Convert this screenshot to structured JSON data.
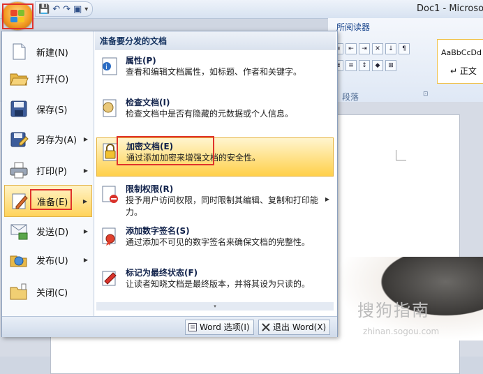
{
  "window": {
    "title": "Doc1 - Microso"
  },
  "quick_access": {
    "save": "💾",
    "undo": "↶",
    "redo": "↷",
    "view": "▣",
    "more": "▾"
  },
  "ribbon": {
    "tab_partial": "所阅读器",
    "group_paragraph": "段落",
    "launcher": "⊡",
    "style_sample": "AaBbCcDd",
    "style_name": "↵ 正文"
  },
  "office_menu": {
    "left_items": [
      {
        "label": "新建(N)",
        "icon": "new-document-icon",
        "has_submenu": false
      },
      {
        "label": "打开(O)",
        "icon": "open-folder-icon",
        "has_submenu": false
      },
      {
        "label": "保存(S)",
        "icon": "save-disk-icon",
        "has_submenu": false
      },
      {
        "label": "另存为(A)",
        "icon": "save-as-icon",
        "has_submenu": true
      },
      {
        "label": "打印(P)",
        "icon": "printer-icon",
        "has_submenu": true
      },
      {
        "label": "准备(E)",
        "icon": "prepare-icon",
        "has_submenu": true,
        "selected": true
      },
      {
        "label": "发送(D)",
        "icon": "send-icon",
        "has_submenu": true
      },
      {
        "label": "发布(U)",
        "icon": "publish-icon",
        "has_submenu": true
      },
      {
        "label": "关闭(C)",
        "icon": "close-folder-icon",
        "has_submenu": false
      }
    ],
    "submenu": {
      "header": "准备要分发的文档",
      "items": [
        {
          "title": "属性(P)",
          "desc": "查看和编辑文档属性，如标题、作者和关键字。",
          "icon": "properties-icon"
        },
        {
          "title": "检查文档(I)",
          "desc": "检查文档中是否有隐藏的元数据或个人信息。",
          "icon": "inspect-document-icon"
        },
        {
          "title": "加密文档(E)",
          "desc": "通过添加加密来增强文档的安全性。",
          "icon": "encrypt-lock-icon",
          "selected": true
        },
        {
          "title": "限制权限(R)",
          "desc": "授予用户访问权限，同时限制其编辑、复制和打印能力。",
          "icon": "restrict-permission-icon",
          "has_submenu": true
        },
        {
          "title": "添加数字签名(S)",
          "desc": "通过添加不可见的数字签名来确保文档的完整性。",
          "icon": "digital-signature-icon"
        },
        {
          "title": "标记为最终状态(F)",
          "desc": "让读者知晓文档是最终版本，并将其设为只读的。",
          "icon": "mark-final-icon"
        }
      ],
      "scroll_arrow": "▾"
    },
    "footer": {
      "options_label": "Word 选项(I)",
      "exit_label": "退出 Word(X)"
    }
  },
  "watermark": {
    "text": "搜狗指南",
    "sub": "zhinan.sogou.com"
  },
  "colors": {
    "highlight": "#ffd35a",
    "annotation_red": "#e0322b",
    "header_text": "#12305e"
  }
}
